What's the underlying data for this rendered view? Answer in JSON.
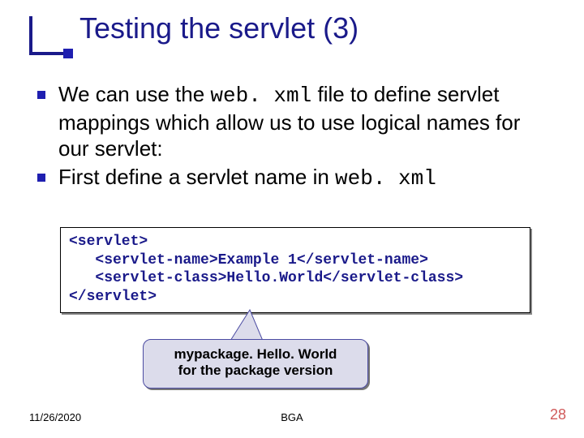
{
  "title": "Testing the servlet (3)",
  "bullets": [
    {
      "pre": "We can use the ",
      "code": "web. xml",
      "post": " file to define servlet mappings which allow us to use logical names for our servlet:"
    },
    {
      "pre": "First define a servlet name in ",
      "code": "web. xml",
      "post": ""
    }
  ],
  "code": {
    "l1": "<servlet>",
    "l2": "   <servlet-name>Example 1</servlet-name>",
    "l3": "   <servlet-class>Hello.World</servlet-class>",
    "l4": "</servlet>"
  },
  "callout": {
    "line1": "mypackage. Hello. World",
    "line2": "for the package version"
  },
  "footer": {
    "date": "11/26/2020",
    "center": "BGA",
    "page": "28"
  }
}
